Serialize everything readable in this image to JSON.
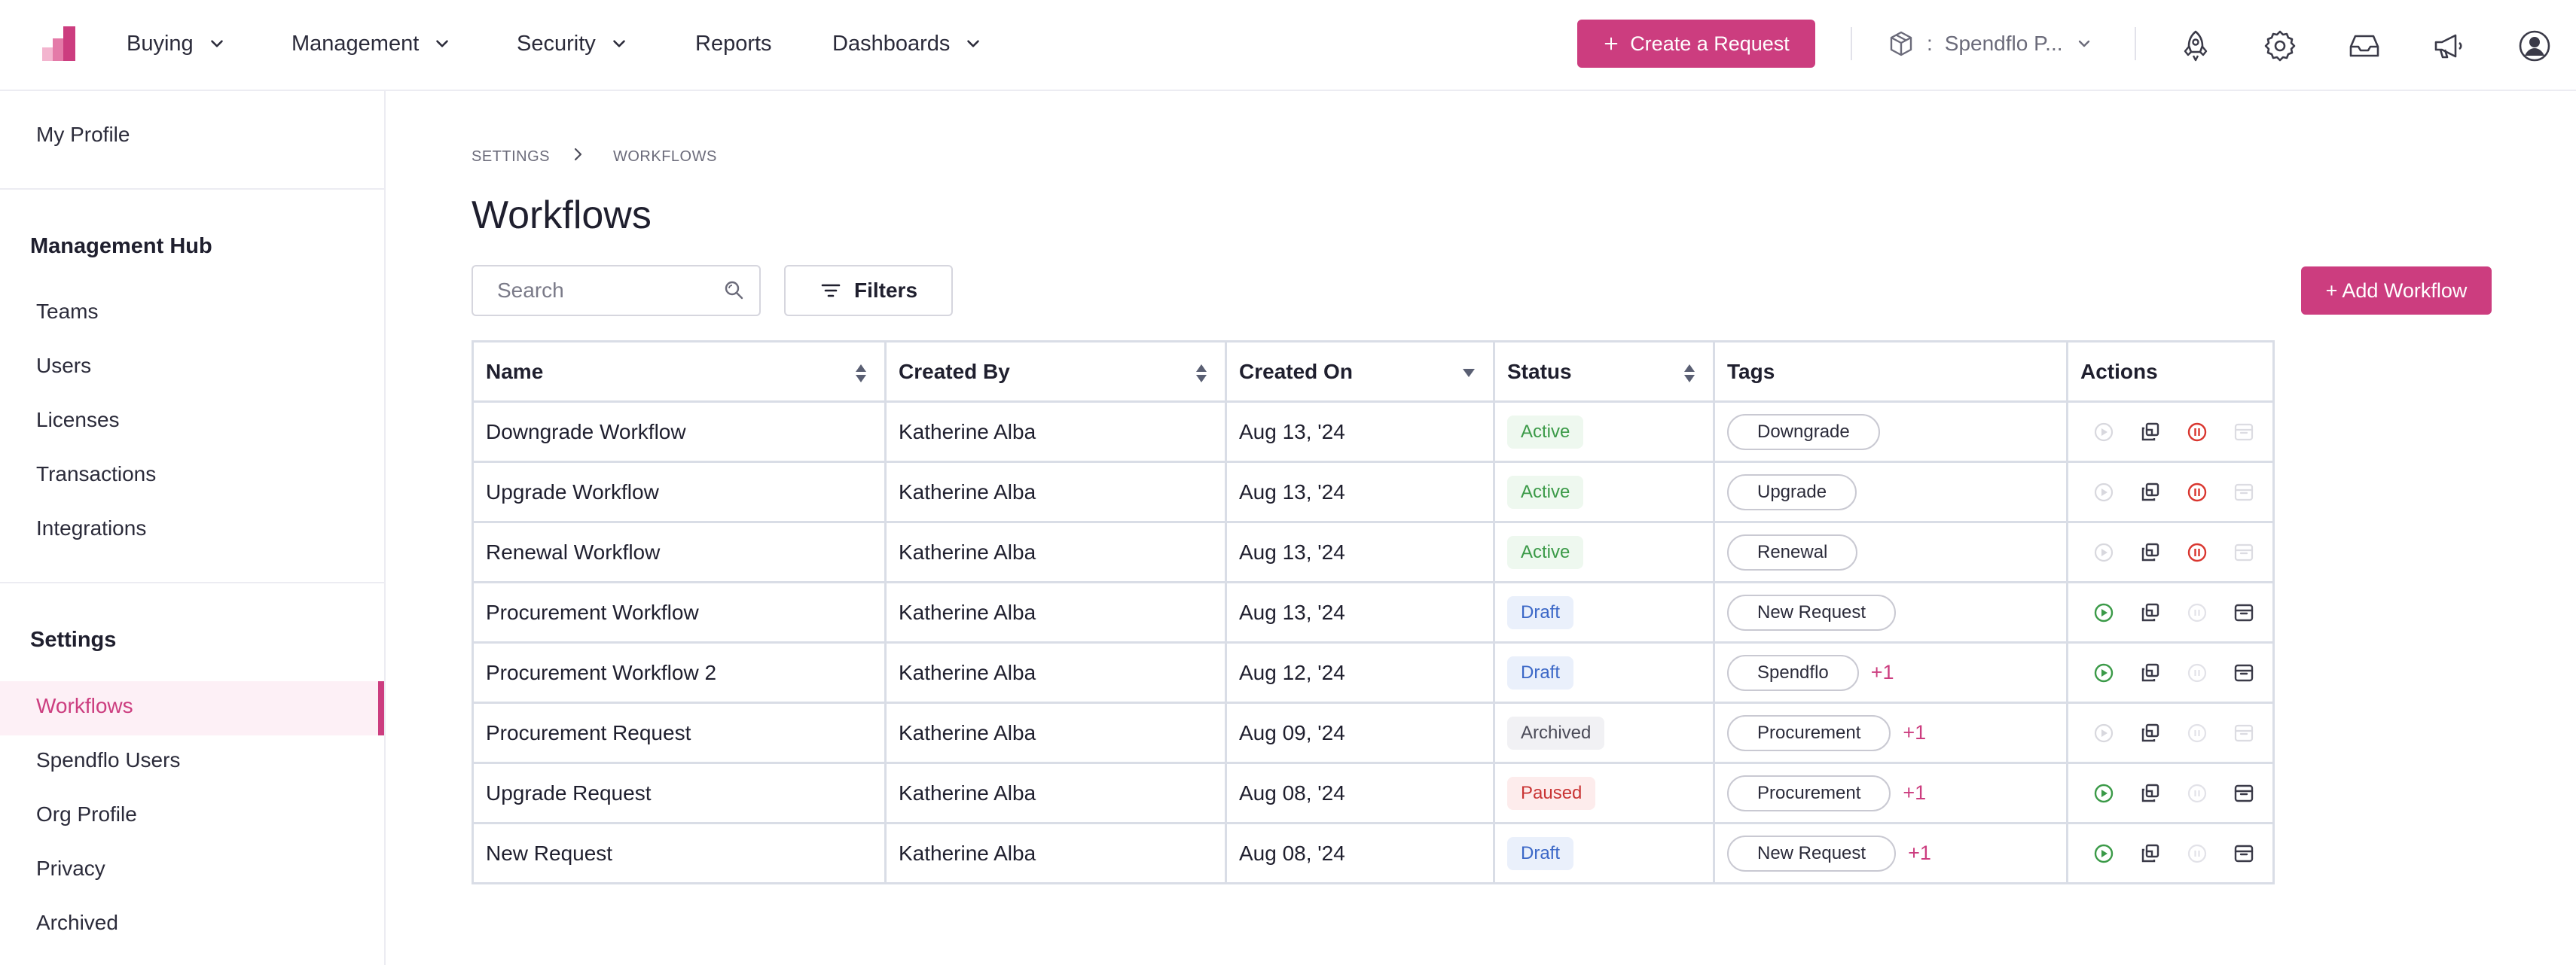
{
  "nav": {
    "items": [
      {
        "label": "Buying",
        "dropdown": true
      },
      {
        "label": "Management",
        "dropdown": true
      },
      {
        "label": "Security",
        "dropdown": true
      },
      {
        "label": "Reports",
        "dropdown": false
      },
      {
        "label": "Dashboards",
        "dropdown": true
      }
    ],
    "create_label": "Create a Request",
    "org_label": "Spendflo P...",
    "org_separator": ":",
    "brand_color": "#cc3d7f"
  },
  "sidebar": {
    "profile": "My Profile",
    "management_title": "Management Hub",
    "management_items": [
      "Teams",
      "Users",
      "Licenses",
      "Transactions",
      "Integrations"
    ],
    "settings_title": "Settings",
    "settings_items": [
      "Workflows",
      "Spendflo Users",
      "Org Profile",
      "Privacy",
      "Archived"
    ],
    "active_item": "Workflows"
  },
  "breadcrumb": {
    "parent": "SETTINGS",
    "current": "WORKFLOWS"
  },
  "page": {
    "title": "Workflows",
    "search_placeholder": "Search",
    "filters_label": "Filters",
    "add_label": "+ Add Workflow"
  },
  "table": {
    "columns": [
      "Name",
      "Created By",
      "Created On",
      "Status",
      "Tags",
      "Actions"
    ],
    "rows": [
      {
        "name": "Downgrade Workflow",
        "created_by": "Katherine Alba",
        "created_on": "Aug 13, '24",
        "status": "Active",
        "tag": "Downgrade",
        "extra": "",
        "actions": [
          "play-disabled",
          "copy",
          "pause",
          "archive-disabled"
        ]
      },
      {
        "name": "Upgrade Workflow",
        "created_by": "Katherine Alba",
        "created_on": "Aug 13, '24",
        "status": "Active",
        "tag": "Upgrade",
        "extra": "",
        "actions": [
          "play-disabled",
          "copy",
          "pause",
          "archive-disabled"
        ]
      },
      {
        "name": "Renewal Workflow",
        "created_by": "Katherine Alba",
        "created_on": "Aug 13, '24",
        "status": "Active",
        "tag": "Renewal",
        "extra": "",
        "actions": [
          "play-disabled",
          "copy",
          "pause",
          "archive-disabled"
        ]
      },
      {
        "name": "Procurement Workflow",
        "created_by": "Katherine Alba",
        "created_on": "Aug 13, '24",
        "status": "Draft",
        "tag": "New Request",
        "extra": "",
        "actions": [
          "play",
          "copy",
          "pause-disabled",
          "archive"
        ]
      },
      {
        "name": "Procurement Workflow 2",
        "created_by": "Katherine Alba",
        "created_on": "Aug 12, '24",
        "status": "Draft",
        "tag": "Spendflo",
        "extra": "+1",
        "actions": [
          "play",
          "copy",
          "pause-disabled",
          "archive"
        ]
      },
      {
        "name": "Procurement Request",
        "created_by": "Katherine Alba",
        "created_on": "Aug 09, '24",
        "status": "Archived",
        "tag": "Procurement",
        "extra": "+1",
        "actions": [
          "play-disabled",
          "copy",
          "pause-disabled",
          "archive-disabled"
        ]
      },
      {
        "name": "Upgrade Request",
        "created_by": "Katherine Alba",
        "created_on": "Aug 08, '24",
        "status": "Paused",
        "tag": "Procurement",
        "extra": "+1",
        "actions": [
          "play",
          "copy",
          "pause-disabled",
          "archive"
        ]
      },
      {
        "name": "New Request",
        "created_by": "Katherine Alba",
        "created_on": "Aug 08, '24",
        "status": "Draft",
        "tag": "New Request",
        "extra": "+1",
        "actions": [
          "play",
          "copy",
          "pause-disabled",
          "archive"
        ]
      }
    ]
  },
  "icons": {
    "header": [
      "rocket-icon",
      "gear-icon",
      "inbox-icon",
      "megaphone-icon",
      "user-avatar-icon"
    ],
    "org": "cube-icon"
  },
  "colors": {
    "active": "#3b9a48",
    "draft": "#3c68c7",
    "paused": "#c93434",
    "archived": "#4b4b58"
  }
}
